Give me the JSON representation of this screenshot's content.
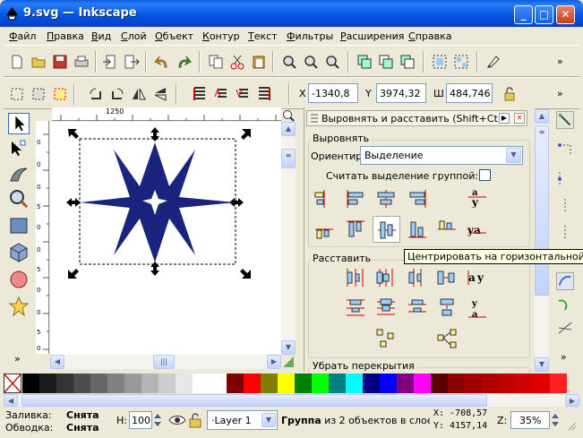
{
  "window": {
    "title": "9.svg — Inkscape"
  },
  "menu": [
    "Файл",
    "Правка",
    "Вид",
    "Слой",
    "Объект",
    "Контур",
    "Текст",
    "Фильтры",
    "Расширения",
    "Справка"
  ],
  "coords": {
    "x_label": "X",
    "x_value": "-1340,8",
    "y_label": "Y",
    "y_value": "3974,32",
    "w_label": "Ш",
    "w_value": "484,746"
  },
  "ruler": {
    "h_label": "1250",
    "v_labels": [
      "0",
      "0",
      "0",
      "5",
      "0",
      "0",
      "5",
      "0",
      "0",
      "5",
      "0"
    ]
  },
  "dock": {
    "title": "Выровнять и расставить (Shift+Ct...",
    "align_section": "Выровнять",
    "relative_label": "Ориентир:",
    "relative_value": "Выделение",
    "group_label": "Считать выделение группой:",
    "distribute_section": "Расставить",
    "overlap_section": "Убрать перекрытия"
  },
  "tooltip": "Центрировать на горизонтальной оси",
  "status": {
    "fill_label": "Заливка:",
    "fill_value": "Снята",
    "stroke_label": "Обводка:",
    "stroke_value": "Снята",
    "opacity_label": "Н:",
    "opacity_value": "100",
    "layer": "·Layer 1",
    "message_bold": "Группа",
    "message_rest": " из 2 объектов в слое ...",
    "cursor_x": "X: -708,57",
    "cursor_y": "Y: 4157,14",
    "zoom_label": "Z:",
    "zoom_value": "35%"
  },
  "colors": {
    "star": "#1a237e",
    "accent": "#316ac5"
  },
  "palette": [
    "#000000",
    "#1a1a1a",
    "#333333",
    "#4d4d4d",
    "#666666",
    "#808080",
    "#999999",
    "#b3b3b3",
    "#cccccc",
    "#e6e6e6",
    "#ffffff",
    "#ffffff",
    "#800000",
    "#ff0000",
    "#808000",
    "#ffff00",
    "#008000",
    "#00ff00",
    "#008080",
    "#00ffff",
    "#000080",
    "#0000ff",
    "#800080",
    "#ff00ff",
    "#5a0000",
    "#8b0000",
    "#a00000",
    "#b00000",
    "#c00000",
    "#d00000",
    "#e00000",
    "#ff2020"
  ]
}
